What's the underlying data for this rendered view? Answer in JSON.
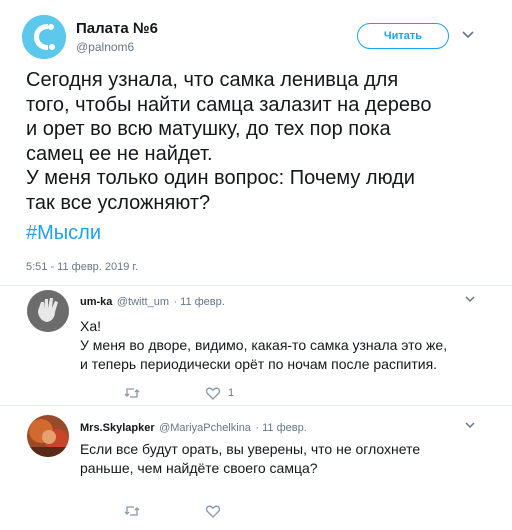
{
  "main_tweet": {
    "display_name": "Палата №6",
    "handle": "@palnom6",
    "follow_label": "Читать",
    "text": "Сегодня узнала, что самка ленивца для\nтого, чтобы найти самца залазит на дерево\nи орет во всю матушку, до тех пор пока\nсамец ее не найдет.\nУ меня только один вопрос: Почему люди\nтак все усложняют?",
    "hashtag": "#Мысли",
    "timestamp": "5:51 - 11 февр. 2019 г."
  },
  "replies": [
    {
      "display_name": "um-ka",
      "handle": "@twitt_um",
      "date": "· 11 февр.",
      "text": "Ха!\nУ меня во дворе, видимо, какая-то самка узнала это же,\nи теперь периодически орёт по ночам после распития.",
      "like_count": "1"
    },
    {
      "display_name": "Mrs.Skylapker",
      "handle": "@MariyaPchelkina",
      "date": "· 11 февр.",
      "text": "Если все будут орать, вы уверены, что не  оглохнете\nраньше, чем найдёте своего самца?",
      "like_count": ""
    }
  ],
  "colors": {
    "accent": "#1da1f2",
    "muted": "#657786",
    "text": "#14171a",
    "divider": "#e6ecf0"
  },
  "icons": {
    "caret": "chevron-down-icon",
    "retweet": "retweet-icon",
    "like": "heart-icon"
  }
}
